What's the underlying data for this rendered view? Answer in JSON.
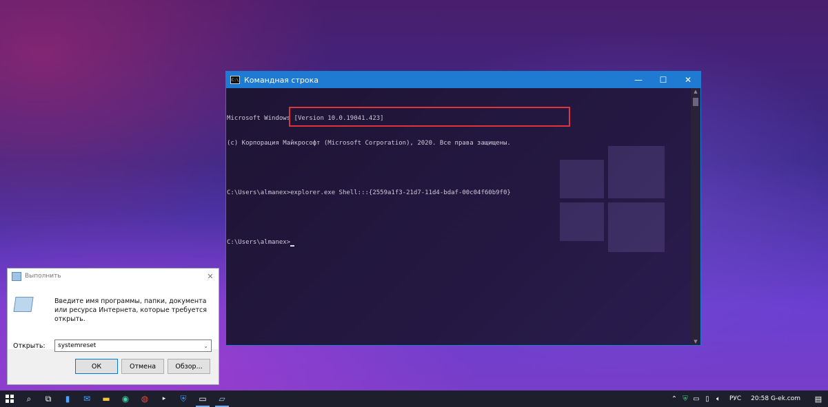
{
  "cmd": {
    "title": "Командная строка",
    "controls": {
      "minimize": "—",
      "maximize": "☐",
      "close": "✕"
    },
    "lines": [
      "Microsoft Windows [Version 10.0.19041.423]",
      "(с) Корпорация Майкрософт (Microsoft Corporation), 2020. Все права защищены.",
      "",
      "C:\\Users\\almanex>explorer.exe Shell:::{2559a1f3-21d7-11d4-bdaf-00c04f60b9f0}",
      "",
      "C:\\Users\\almanex>"
    ],
    "icon_label": "C:\\"
  },
  "run": {
    "title": "Выполнить",
    "close": "✕",
    "description": "Введите имя программы, папки, документа или ресурса Интернета, которые требуется открыть.",
    "open_label": "Открыть:",
    "input_value": "systemreset",
    "buttons": {
      "ok": "ОК",
      "cancel": "Отмена",
      "browse": "Обзор..."
    }
  },
  "taskbar": {
    "icons": [
      "start-icon",
      "search-icon",
      "task-view-icon",
      "phone-icon",
      "mail-icon",
      "file-explorer-icon",
      "edge-icon",
      "chrome-icon",
      "media-icon",
      "defender-icon",
      "cmd-icon",
      "run-icon"
    ],
    "tray": {
      "language": "РУС",
      "clock": "20:58 G-ek.com"
    }
  },
  "colors": {
    "cmd_titlebar": "#1f7ad1",
    "highlight": "#e0333c",
    "taskbar": "#1d1f2d"
  }
}
